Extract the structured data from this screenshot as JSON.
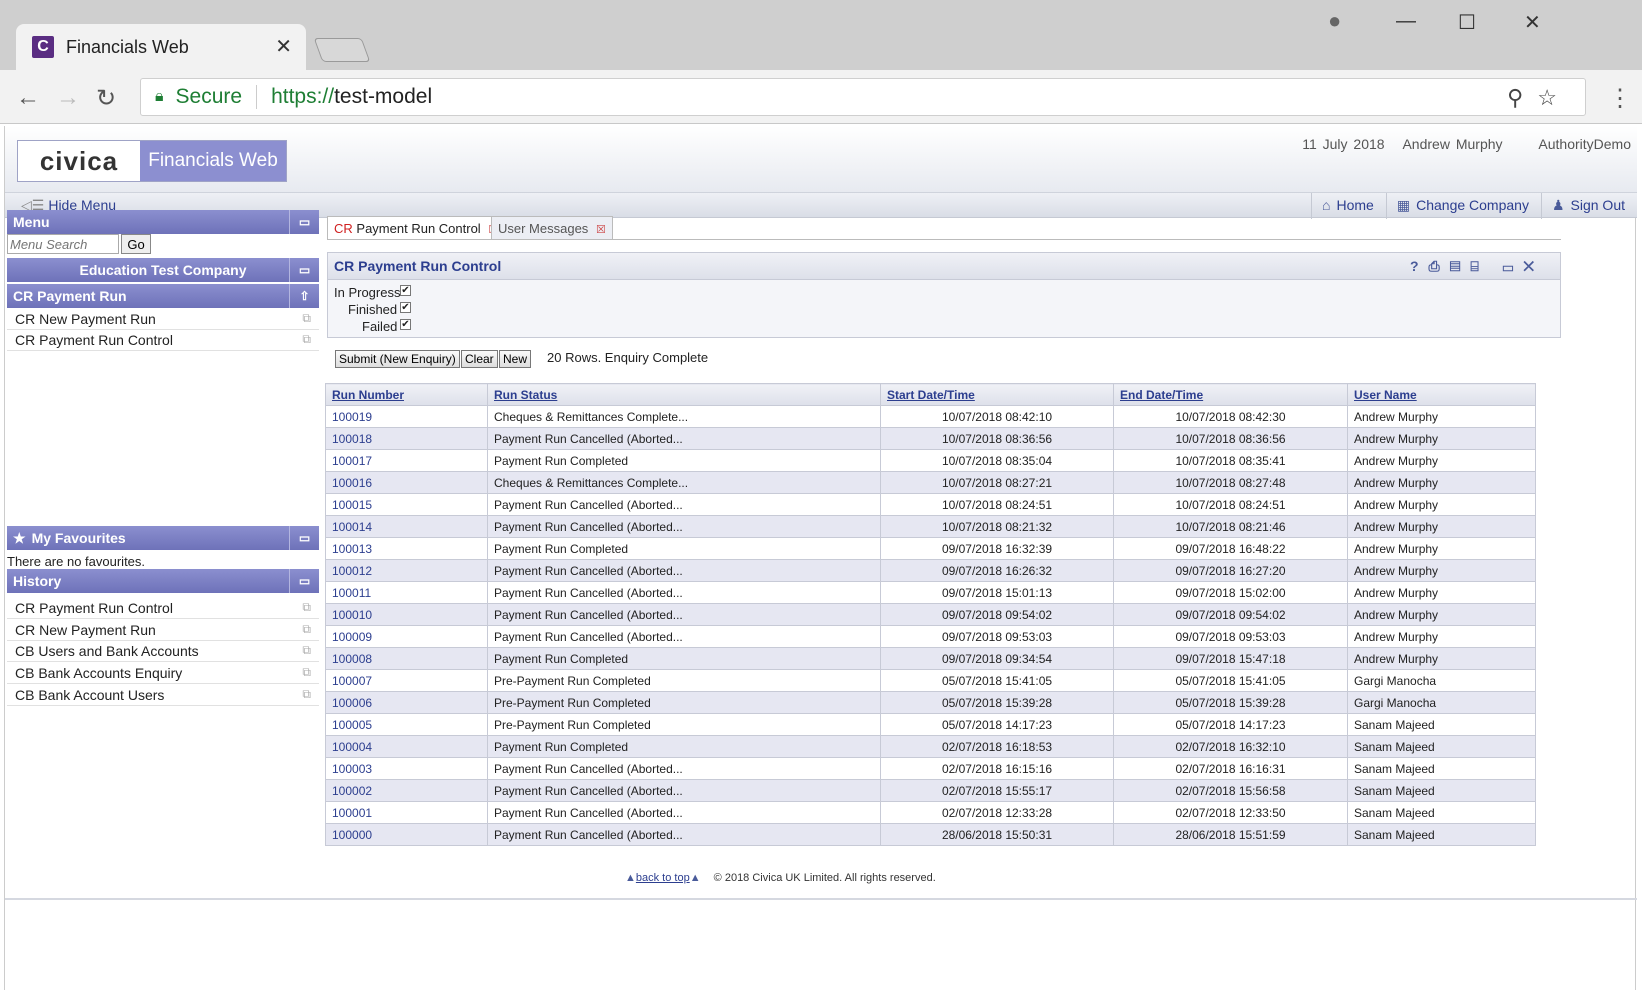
{
  "browser": {
    "tab_title": "Financials Web",
    "favicon_letter": "C",
    "secure_label": "Secure",
    "url_protocol": "https://",
    "url_host": "test-model"
  },
  "header": {
    "logo_text": "civica",
    "product_name": "Financials Web",
    "date": "11 July 2018",
    "user": "Andrew Murphy",
    "authority": "AuthorityDemo"
  },
  "toolbar": {
    "hide_menu": "Hide Menu",
    "home": "Home",
    "change_company": "Change Company",
    "sign_out": "Sign Out"
  },
  "sidebar": {
    "menu_title": "Menu",
    "search_placeholder": "Menu Search",
    "go_label": "Go",
    "company": "Education Test Company",
    "section": "CR Payment Run",
    "items": [
      {
        "label": "CR New Payment Run"
      },
      {
        "label": "CR Payment Run Control"
      }
    ],
    "favourites_title": "My Favourites",
    "favourites_empty": "There are no favourites.",
    "history_title": "History",
    "history": [
      {
        "label": "CR Payment Run Control"
      },
      {
        "label": "CR New Payment Run"
      },
      {
        "label": "CB Users and Bank Accounts"
      },
      {
        "label": "CB Bank Accounts Enquiry"
      },
      {
        "label": "CB Bank Account Users"
      }
    ]
  },
  "content": {
    "tabs": [
      {
        "prefix": "CR",
        "label": "Payment Run Control"
      },
      {
        "label": "User Messages"
      }
    ],
    "title": "CR Payment Run Control",
    "filters": [
      {
        "label": "In Progress",
        "checked": true
      },
      {
        "label": "Finished",
        "checked": true
      },
      {
        "label": "Failed",
        "checked": true
      }
    ],
    "submit_label": "Submit (New Enquiry)",
    "clear_label": "Clear",
    "new_label": "New",
    "rows_info": "20 Rows. Enquiry Complete",
    "columns": [
      "Run Number",
      "Run Status",
      "Start Date/Time",
      "End Date/Time",
      "User Name"
    ],
    "rows": [
      [
        "100019",
        "Cheques & Remittances Complete...",
        "10/07/2018 08:42:10",
        "10/07/2018 08:42:30",
        "Andrew Murphy"
      ],
      [
        "100018",
        "Payment Run Cancelled (Aborted...",
        "10/07/2018 08:36:56",
        "10/07/2018 08:36:56",
        "Andrew Murphy"
      ],
      [
        "100017",
        "Payment Run Completed",
        "10/07/2018 08:35:04",
        "10/07/2018 08:35:41",
        "Andrew Murphy"
      ],
      [
        "100016",
        "Cheques & Remittances Complete...",
        "10/07/2018 08:27:21",
        "10/07/2018 08:27:48",
        "Andrew Murphy"
      ],
      [
        "100015",
        "Payment Run Cancelled (Aborted...",
        "10/07/2018 08:24:51",
        "10/07/2018 08:24:51",
        "Andrew Murphy"
      ],
      [
        "100014",
        "Payment Run Cancelled (Aborted...",
        "10/07/2018 08:21:32",
        "10/07/2018 08:21:46",
        "Andrew Murphy"
      ],
      [
        "100013",
        "Payment Run Completed",
        "09/07/2018 16:32:39",
        "09/07/2018 16:48:22",
        "Andrew Murphy"
      ],
      [
        "100012",
        "Payment Run Cancelled (Aborted...",
        "09/07/2018 16:26:32",
        "09/07/2018 16:27:20",
        "Andrew Murphy"
      ],
      [
        "100011",
        "Payment Run Cancelled (Aborted...",
        "09/07/2018 15:01:13",
        "09/07/2018 15:02:00",
        "Andrew Murphy"
      ],
      [
        "100010",
        "Payment Run Cancelled (Aborted...",
        "09/07/2018 09:54:02",
        "09/07/2018 09:54:02",
        "Andrew Murphy"
      ],
      [
        "100009",
        "Payment Run Cancelled (Aborted...",
        "09/07/2018 09:53:03",
        "09/07/2018 09:53:03",
        "Andrew Murphy"
      ],
      [
        "100008",
        "Payment Run Completed",
        "09/07/2018 09:34:54",
        "09/07/2018 15:47:18",
        "Andrew Murphy"
      ],
      [
        "100007",
        "Pre-Payment Run Completed",
        "05/07/2018 15:41:05",
        "05/07/2018 15:41:05",
        "Gargi Manocha"
      ],
      [
        "100006",
        "Pre-Payment Run Completed",
        "05/07/2018 15:39:28",
        "05/07/2018 15:39:28",
        "Gargi Manocha"
      ],
      [
        "100005",
        "Pre-Payment Run Completed",
        "05/07/2018 14:17:23",
        "05/07/2018 14:17:23",
        "Sanam Majeed"
      ],
      [
        "100004",
        "Payment Run Completed",
        "02/07/2018 16:18:53",
        "02/07/2018 16:32:10",
        "Sanam Majeed"
      ],
      [
        "100003",
        "Payment Run Cancelled (Aborted...",
        "02/07/2018 16:15:16",
        "02/07/2018 16:16:31",
        "Sanam Majeed"
      ],
      [
        "100002",
        "Payment Run Cancelled (Aborted...",
        "02/07/2018 15:55:17",
        "02/07/2018 15:56:58",
        "Sanam Majeed"
      ],
      [
        "100001",
        "Payment Run Cancelled (Aborted...",
        "02/07/2018 12:33:28",
        "02/07/2018 12:33:50",
        "Sanam Majeed"
      ],
      [
        "100000",
        "Payment Run Cancelled (Aborted...",
        "28/06/2018 15:50:31",
        "28/06/2018 15:51:59",
        "Sanam Majeed"
      ]
    ]
  },
  "footer": {
    "back_to_top": "back to top",
    "copyright": "© 2018 Civica UK Limited. All rights reserved."
  },
  "colors": {
    "accent": "#6e72b9",
    "link": "#2c3e8f",
    "secure_green": "#1e7e34"
  }
}
